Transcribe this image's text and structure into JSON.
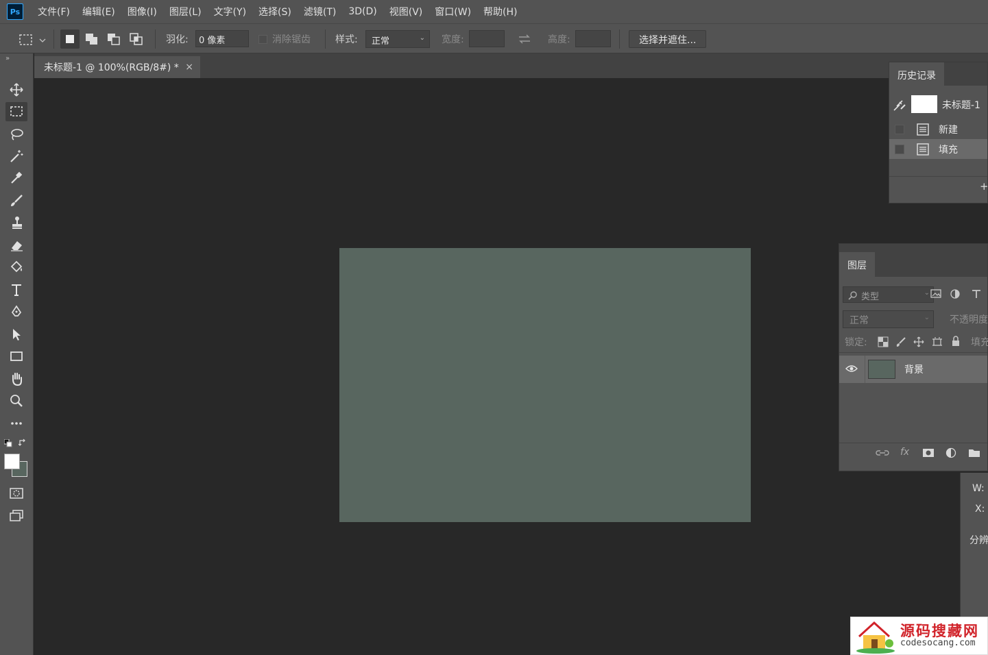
{
  "app": {
    "logo": "Ps",
    "accent": "#31a8ff",
    "logo_bg": "#001e36"
  },
  "menu": [
    "文件(F)",
    "编辑(E)",
    "图像(I)",
    "图层(L)",
    "文字(Y)",
    "选择(S)",
    "滤镜(T)",
    "3D(D)",
    "视图(V)",
    "窗口(W)",
    "帮助(H)"
  ],
  "options": {
    "feather_label": "羽化:",
    "feather_value": "0 像素",
    "antialias_label": "消除锯齿",
    "style_label": "样式:",
    "style_value": "正常",
    "width_label": "宽度:",
    "height_label": "高度:",
    "select_mask_button": "选择并遮住..."
  },
  "document": {
    "tab_title": "未标题-1 @ 100%(RGB/8#) *",
    "close_glyph": "×",
    "fill_color": "#58665f"
  },
  "history": {
    "tab": "历史记录",
    "snapshot_label": "未标题-1",
    "items": [
      "新建",
      "填充"
    ]
  },
  "layers": {
    "tab": "图层",
    "filter_placeholder": "类型",
    "blend_mode": "正常",
    "opacity_label": "不透明度",
    "lock_label": "锁定:",
    "fill_label": "填充",
    "layer_name": "背景"
  },
  "properties": {
    "w_label": "W:",
    "x_label": "X:",
    "split_label": "分辨"
  },
  "colors": {
    "foreground": "#ffffff",
    "background": "#58665f"
  },
  "watermark": {
    "title": "源码搜藏网",
    "url": "codesocang.com"
  }
}
